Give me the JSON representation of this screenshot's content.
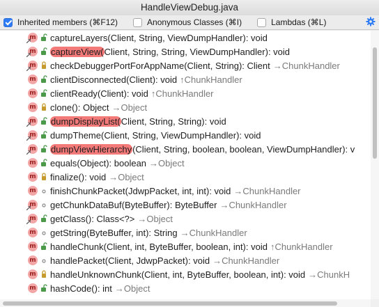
{
  "window": {
    "title": "HandleViewDebug.java"
  },
  "options": {
    "inherited": {
      "label": "Inherited members (⌘F12)",
      "checked": true
    },
    "anonymous": {
      "label": "Anonymous Classes (⌘I)",
      "checked": false
    },
    "lambdas": {
      "label": "Lambdas (⌘L)",
      "checked": false
    }
  },
  "colors": {
    "accent": "#2e7cf6",
    "highlight": "#f47a7a",
    "method_icon": "#f3a6a6",
    "inherited_text": "#7a7a7a"
  },
  "members": [
    {
      "icon": "method-icon",
      "vis": "public-icon",
      "override": true,
      "highlight": "",
      "name": "captureLayers",
      "sig": "(Client, String, ViewDumpHandler): void",
      "inh": ""
    },
    {
      "icon": "method-icon",
      "vis": "public-icon",
      "override": true,
      "highlight": "captureView(",
      "name": "",
      "sig": "Client, String, String, ViewDumpHandler): void",
      "inh": ""
    },
    {
      "icon": "method-icon",
      "vis": "protected-icon",
      "override": true,
      "highlight": "",
      "name": "checkDebuggerPortForAppName",
      "sig": "(Client, String): Client",
      "inh": "→ChunkHandler"
    },
    {
      "icon": "method-icon",
      "vis": "public-icon",
      "override": false,
      "highlight": "",
      "name": "clientDisconnected",
      "sig": "(Client): void",
      "inh": "↑ChunkHandler"
    },
    {
      "icon": "method-icon",
      "vis": "public-icon",
      "override": false,
      "highlight": "",
      "name": "clientReady",
      "sig": "(Client): void",
      "inh": "↑ChunkHandler"
    },
    {
      "icon": "method-icon",
      "vis": "protected-icon",
      "override": false,
      "highlight": "",
      "name": "clone",
      "sig": "(): Object",
      "inh": "→Object"
    },
    {
      "icon": "method-icon",
      "vis": "public-icon",
      "override": true,
      "highlight": "dumpDisplayList(",
      "name": "",
      "sig": "Client, String, String): void",
      "inh": ""
    },
    {
      "icon": "method-icon",
      "vis": "public-icon",
      "override": true,
      "highlight": "",
      "name": "dumpTheme",
      "sig": "(Client, String, ViewDumpHandler): void",
      "inh": ""
    },
    {
      "icon": "method-icon",
      "vis": "public-icon",
      "override": true,
      "highlight": "dumpViewHierarchy",
      "name": "",
      "sig": "(Client, String, boolean, boolean, ViewDumpHandler): v",
      "inh": ""
    },
    {
      "icon": "method-icon",
      "vis": "public-icon",
      "override": false,
      "highlight": "",
      "name": "equals",
      "sig": "(Object): boolean",
      "inh": "→Object"
    },
    {
      "icon": "method-icon",
      "vis": "protected-icon",
      "override": false,
      "highlight": "",
      "name": "finalize",
      "sig": "(): void",
      "inh": "→Object"
    },
    {
      "icon": "method-icon",
      "vis": "package-icon",
      "override": false,
      "highlight": "",
      "name": "finishChunkPacket",
      "sig": "(JdwpPacket, int, int): void",
      "inh": "→ChunkHandler"
    },
    {
      "icon": "method-icon",
      "vis": "package-icon",
      "override": true,
      "highlight": "",
      "name": "getChunkDataBuf",
      "sig": "(ByteBuffer): ByteBuffer",
      "inh": "→ChunkHandler"
    },
    {
      "icon": "method-icon",
      "vis": "public-icon",
      "override": true,
      "highlight": "",
      "name": "getClass",
      "sig": "(): Class<?>",
      "inh": "→Object"
    },
    {
      "icon": "method-icon",
      "vis": "package-icon",
      "override": false,
      "highlight": "",
      "name": "getString",
      "sig": "(ByteBuffer, int): String",
      "inh": "→ChunkHandler"
    },
    {
      "icon": "method-icon",
      "vis": "public-icon",
      "override": false,
      "highlight": "",
      "name": "handleChunk",
      "sig": "(Client, int, ByteBuffer, boolean, int): void",
      "inh": "↑ChunkHandler"
    },
    {
      "icon": "method-icon",
      "vis": "package-icon",
      "override": false,
      "highlight": "",
      "name": "handlePacket",
      "sig": "(Client, JdwpPacket): void",
      "inh": "→ChunkHandler"
    },
    {
      "icon": "method-icon",
      "vis": "protected-icon",
      "override": false,
      "highlight": "",
      "name": "handleUnknownChunk",
      "sig": "(Client, int, ByteBuffer, boolean, int): void",
      "inh": "→ChunkH"
    },
    {
      "icon": "method-icon",
      "vis": "public-icon",
      "override": false,
      "highlight": "",
      "name": "hashCode",
      "sig": "(): int",
      "inh": "→Object"
    }
  ]
}
